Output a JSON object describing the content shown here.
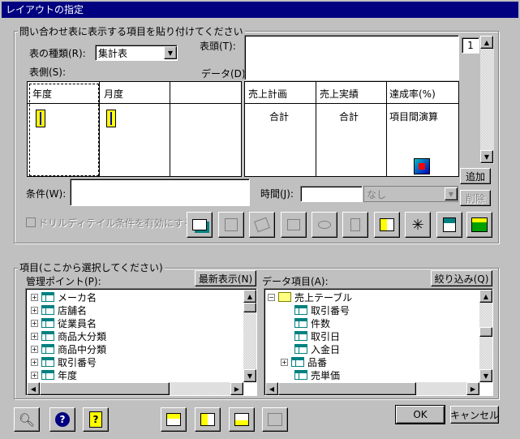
{
  "window": {
    "title": "レイアウトの指定"
  },
  "layout_group": {
    "label": "問い合わせ表に表示する項目を貼り付けてください"
  },
  "table_kind": {
    "label": "表の種類(R):",
    "value": "集計表"
  },
  "header_label": "表頭(T):",
  "data_label": "データ(D):",
  "side_label": "表側(S):",
  "page_number": "1",
  "side_columns": [
    "年度",
    "月度"
  ],
  "data_columns": [
    {
      "name": "売上計画",
      "agg": "合計"
    },
    {
      "name": "売上実績",
      "agg": "合計"
    },
    {
      "name": "達成率(%)",
      "agg": "項目間演算"
    }
  ],
  "buttons": {
    "add": "追加",
    "delete": "削除",
    "refresh": "最新表示(N)",
    "filter": "絞り込み(Q)",
    "ok": "OK",
    "cancel": "キャンセル"
  },
  "condition_label": "条件(W):",
  "time_label": "時間(J):",
  "time_value": "なし",
  "drill_checkbox": "ドリルディテイル条件を有効にする(L)",
  "items_group": {
    "label": "項目(ここから選択してください)"
  },
  "mgmt_label": "管理ポイント(P):",
  "data_items_label": "データ項目(A):",
  "mgmt_items": [
    "メーカ名",
    "店舗名",
    "従業員名",
    "商品大分類",
    "商品中分類",
    "取引番号",
    "年度"
  ],
  "data_root": "売上テーブル",
  "data_items": [
    "取引番号",
    "件数",
    "取引日",
    "入金日",
    "品番",
    "売単価"
  ],
  "icons": [
    "search-icon",
    "help-icon",
    "question-icon"
  ]
}
